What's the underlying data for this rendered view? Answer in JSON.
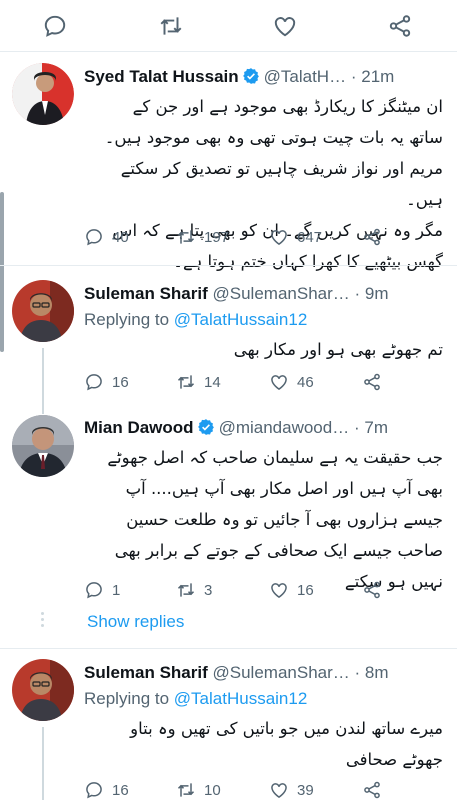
{
  "top_actions": [
    "reply-icon",
    "retweet-icon",
    "like-icon",
    "share-icon"
  ],
  "tweets": [
    {
      "name": "Syed Talat Hussain",
      "verified": true,
      "handle": "@TalatH…",
      "dot": "·",
      "time": "21m",
      "replying_to": "",
      "lines": [
        "ان میٹنگز کا ریکارڈ بھی موجود ہے اور جن کے",
        "ساتھ یہ بات چیت ہوتی تھی وہ بھی موجود ہیں۔",
        "مریم اور نواز شریف چاہیں تو تصدیق کر سکتے ہیں۔",
        "مگر وہ نہیں کریں گے۔ ان کو بھی پتا ہے کہ اس",
        "گھس بیٹھیے کا کھرا کہاں ختم ہوتا ہے۔"
      ],
      "replies": "40",
      "retweets": "197",
      "likes": "647"
    },
    {
      "name": "Suleman Sharif",
      "verified": false,
      "handle": "@SulemanShar…",
      "dot": "·",
      "time": "9m",
      "replying_label": "Replying to",
      "replying_to": "@TalatHussain12",
      "lines": [
        "تم جھوٹے بھی ہو اور مکار بھی"
      ],
      "replies": "16",
      "retweets": "14",
      "likes": "46"
    },
    {
      "name": "Mian Dawood",
      "verified": true,
      "handle": "@miandawood…",
      "dot": "·",
      "time": "7m",
      "replying_to": "",
      "lines": [
        "جب حقیقت یہ ہے سلیمان صاحب کہ اصل جھوٹے",
        "بھی آپ ہیں اور اصل مکار بھی آپ ہیں.... آپ",
        "جیسے ہزاروں بھی آ جائیں تو وہ طلعت حسین",
        "صاحب جیسے ایک صحافی کے جوتے کے برابر بھی",
        "نہیں ہو سکتے"
      ],
      "replies": "1",
      "retweets": "3",
      "likes": "16"
    },
    {
      "name": "Suleman Sharif",
      "verified": false,
      "handle": "@SulemanShar…",
      "dot": "·",
      "time": "8m",
      "replying_label": "Replying to",
      "replying_to": "@TalatHussain12",
      "lines": [
        "میرے ساتھ لندن میں جو باتیں کی تھیں وہ بتاو",
        "جھوٹے صحافی"
      ],
      "replies": "16",
      "retweets": "10",
      "likes": "39"
    }
  ],
  "show_replies": "Show replies",
  "colors": {
    "accent": "#1d9bf0",
    "muted": "#536471",
    "border": "#e6ecf0"
  }
}
